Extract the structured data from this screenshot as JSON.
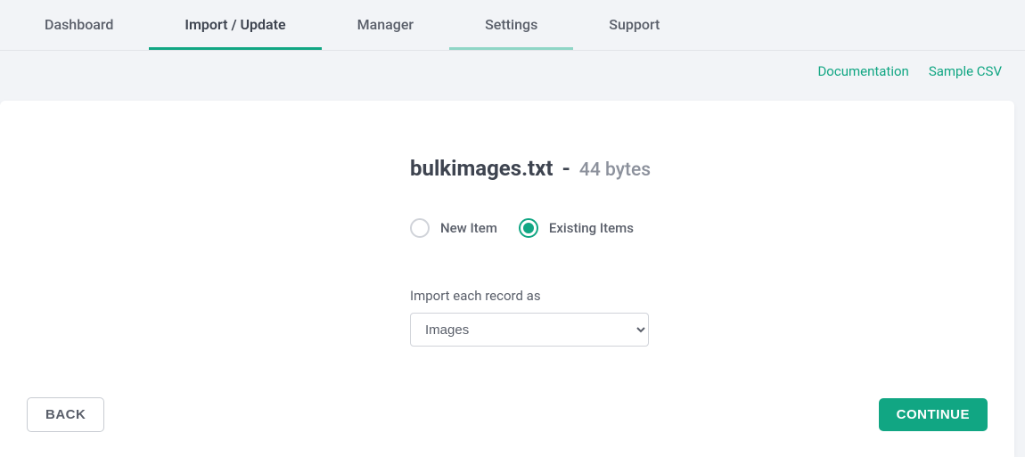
{
  "tabs": {
    "dashboard": "Dashboard",
    "import_update": "Import / Update",
    "manager": "Manager",
    "settings": "Settings",
    "support": "Support"
  },
  "sublinks": {
    "documentation": "Documentation",
    "sample_csv": "Sample CSV"
  },
  "file": {
    "name": "bulkimages.txt",
    "dash": "-",
    "size": "44 bytes"
  },
  "radios": {
    "new_item": "New Item",
    "existing_items": "Existing Items"
  },
  "import": {
    "label": "Import each record as",
    "selected": "Images"
  },
  "buttons": {
    "back": "BACK",
    "continue": "CONTINUE"
  }
}
